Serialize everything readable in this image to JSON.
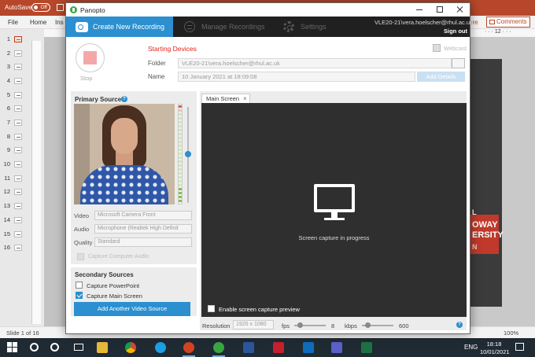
{
  "powerpoint": {
    "autosave_label": "AutoSave",
    "autosave_state": "Off",
    "ribbon_tabs": [
      "File",
      "Home",
      "Ins"
    ],
    "share_label": "are",
    "comments_label": "Comments",
    "ruler_marks": "· · · 12 · · ·",
    "slide_numbers": [
      "1",
      "2",
      "3",
      "4",
      "5",
      "6",
      "7",
      "8",
      "9",
      "10",
      "11",
      "12",
      "13",
      "14",
      "15",
      "16"
    ],
    "slide_text": [
      "L",
      "OWAY",
      "ERSITY",
      "N"
    ],
    "status_slide": "Slide 1 of 16",
    "zoom": "100%"
  },
  "taskbar": {
    "lang": "ENG",
    "time": "18:18",
    "date": "10/01/2021"
  },
  "panopto": {
    "title": "Panopto",
    "nav": {
      "create": "Create New Recording",
      "manage": "Manage Recordings",
      "settings": "Settings"
    },
    "user": "VLE20-21\\vera.hoelscher@rhul.ac.uk",
    "signout": "Sign out",
    "record_label": "Stop",
    "status": "Starting Devices",
    "webcast_label": "Webcast",
    "folder_label": "Folder",
    "folder_value": "VLE20-21\\vera.hoelscher@rhul.ac.uk",
    "name_label": "Name",
    "name_value": "10 January 2021 at 18:09:08",
    "add_details": "Add Details",
    "primary_sources": {
      "heading": "Primary Sources",
      "video_label": "Video",
      "video_value": "Microsoft Camera Front",
      "audio_label": "Audio",
      "audio_value": "Microphone (Realtek High Definit",
      "quality_label": "Quality",
      "quality_value": "Standard",
      "capture_computer_audio": "Capture Computer Audio"
    },
    "secondary_sources": {
      "heading": "Secondary Sources",
      "capture_powerpoint": "Capture PowerPoint",
      "capture_powerpoint_checked": false,
      "capture_main_screen": "Capture Main Screen",
      "capture_main_screen_checked": true,
      "add_video_source": "Add Another Video Source"
    },
    "main_screen": {
      "tab": "Main Screen",
      "tab_close": "×",
      "capture_text": "Screen capture in progress",
      "preview_label": "Enable screen capture preview",
      "resolution_label": "Resolution",
      "resolution_value": "1920 x 1080",
      "fps_label": "fps",
      "fps_value": "8",
      "kbps_label": "kbps",
      "kbps_value": "600"
    },
    "help_glyph": "?",
    "accent": "#2b8fd0",
    "status_color": "#e2221a"
  }
}
